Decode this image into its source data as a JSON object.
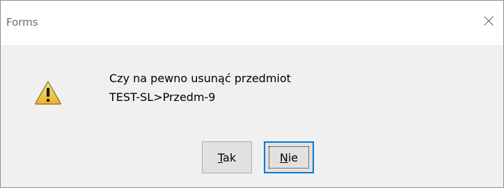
{
  "window": {
    "title": "Forms"
  },
  "dialog": {
    "icon": "warning-icon",
    "message_line1": "Czy na pewno usunąć przedmiot",
    "message_line2": "TEST-SL>Przedm-9"
  },
  "buttons": {
    "yes": {
      "mnemonic": "T",
      "rest": "ak"
    },
    "no": {
      "mnemonic": "N",
      "rest": "ie"
    }
  },
  "colors": {
    "focus_border": "#0078d7",
    "warning_fill": "#f7d24a"
  }
}
